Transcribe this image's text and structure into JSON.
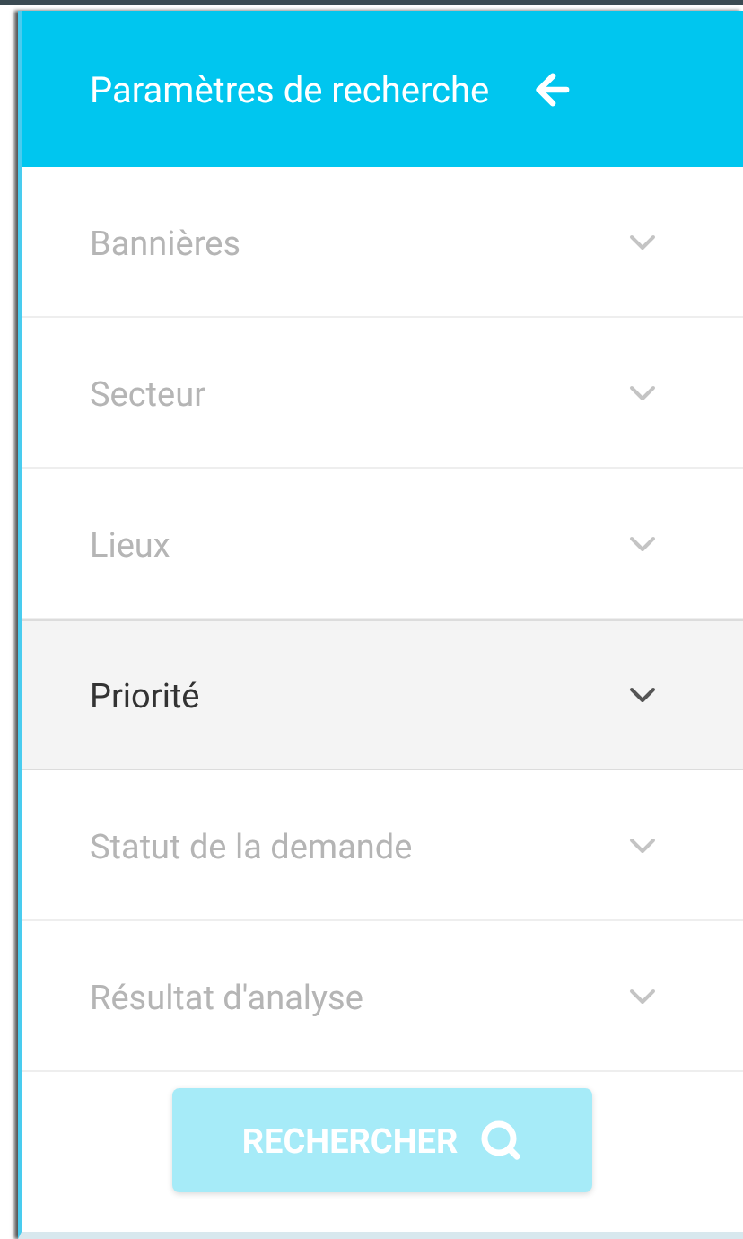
{
  "header": {
    "title": "Paramètres de recherche"
  },
  "filters": [
    {
      "label": "Bannières",
      "highlighted": false
    },
    {
      "label": "Secteur",
      "highlighted": false
    },
    {
      "label": "Lieux",
      "highlighted": false
    },
    {
      "label": "Priorité",
      "highlighted": true
    },
    {
      "label": "Statut de la demande",
      "highlighted": false
    },
    {
      "label": "Résultat d'analyse",
      "highlighted": false
    }
  ],
  "search_button": {
    "label": "RECHERCHER",
    "disabled": true
  }
}
